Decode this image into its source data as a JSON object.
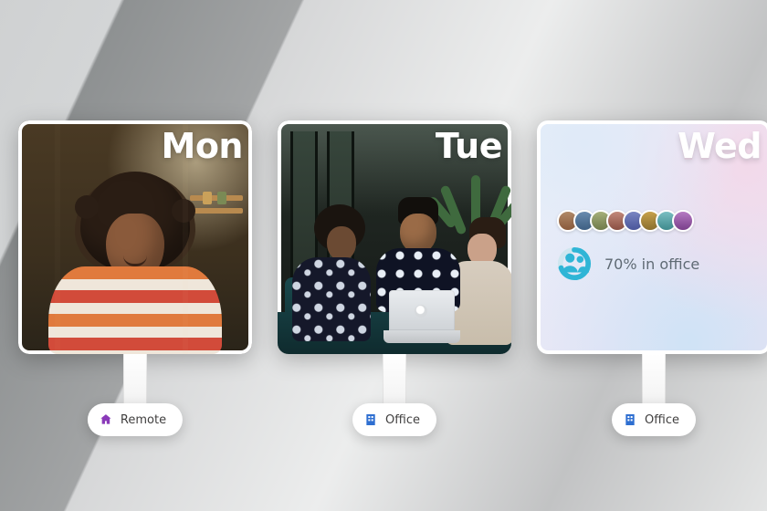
{
  "days": [
    {
      "label": "Mon",
      "location": {
        "type": "remote",
        "label": "Remote",
        "icon": "home-icon",
        "icon_color": "#8a3ab9"
      }
    },
    {
      "label": "Tue",
      "location": {
        "type": "office",
        "label": "Office",
        "icon": "building-icon",
        "icon_color": "#2f6fd1"
      }
    },
    {
      "label": "Wed",
      "location": {
        "type": "office",
        "label": "Office",
        "icon": "building-icon",
        "icon_color": "#2f6fd1"
      },
      "occupancy": {
        "percent": 70,
        "text": "70% in office",
        "ring_color": "#2fb5d6",
        "ring_bg": "#cfe6ef",
        "center_icon": "people-icon",
        "center_icon_color": "#2fb5d6",
        "attendee_count": 8
      }
    }
  ]
}
